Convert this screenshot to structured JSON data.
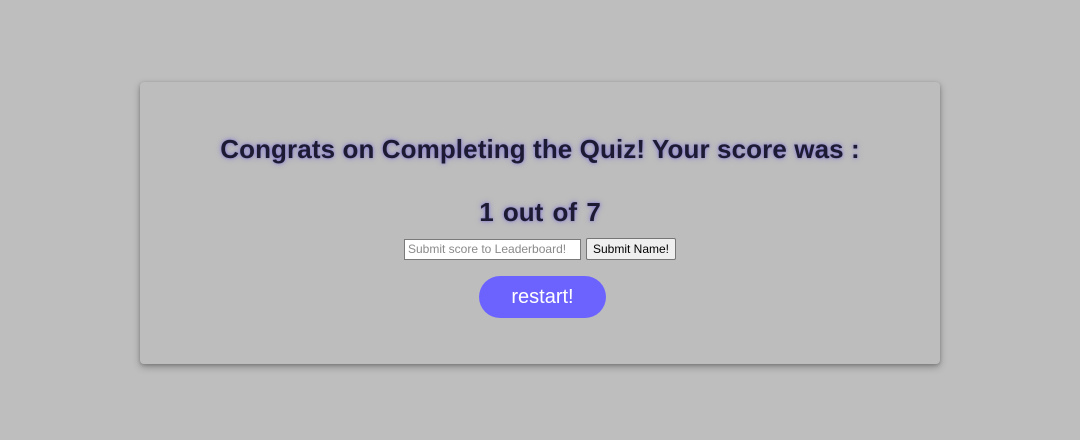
{
  "quiz_result": {
    "heading": "Congrats on Completing the Quiz! Your score was :",
    "score": "1",
    "out_of_label": "out of",
    "total": "7"
  },
  "leaderboard_form": {
    "name_placeholder": "Submit score to Leaderboard!",
    "name_value": "",
    "submit_label": "Submit Name!"
  },
  "restart": {
    "label": "restart!"
  },
  "colors": {
    "page_background": "#bebebe",
    "accent": "#6c63ff",
    "heading_text": "#1c1b33"
  }
}
